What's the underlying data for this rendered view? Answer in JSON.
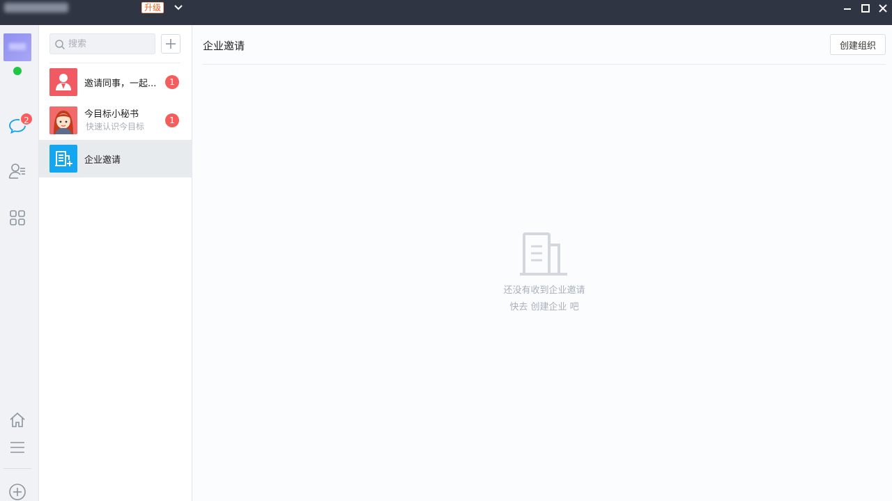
{
  "titlebar": {
    "upgrade_label": "升级"
  },
  "rail": {
    "messages_badge": "2"
  },
  "convlist": {
    "search_placeholder": "搜索",
    "items": [
      {
        "title": "邀请同事，一起...",
        "subtitle": "",
        "badge": "1"
      },
      {
        "title": "今目标小秘书",
        "subtitle": "快速认识今目标",
        "badge": "1"
      },
      {
        "title": "企业邀请",
        "subtitle": "",
        "badge": ""
      }
    ]
  },
  "main": {
    "title": "企业邀请",
    "create_org_label": "创建组织",
    "empty_line1": "还没有收到企业邀请",
    "empty_line2": "快去 创建企业 吧"
  },
  "colors": {
    "titlebar_bg": "#2f3542",
    "badge_red": "#f55d5d",
    "online_green": "#1fc744",
    "enterprise_blue": "#14a6f0",
    "invite_red": "#f05a63"
  }
}
